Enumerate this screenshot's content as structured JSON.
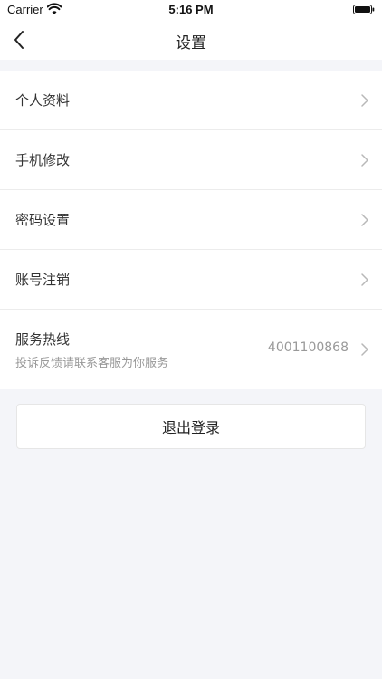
{
  "status_bar": {
    "carrier": "Carrier",
    "time": "5:16 PM"
  },
  "nav": {
    "title": "设置",
    "back_icon": "chevron-left-icon"
  },
  "settings": {
    "items": [
      {
        "label": "个人资料",
        "icon": "chevron-right-icon"
      },
      {
        "label": "手机修改",
        "icon": "chevron-right-icon"
      },
      {
        "label": "密码设置",
        "icon": "chevron-right-icon"
      },
      {
        "label": "账号注销",
        "icon": "chevron-right-icon"
      }
    ],
    "hotline": {
      "label": "服务热线",
      "subtitle": "投诉反馈请联系客服为你服务",
      "value": "4001100868",
      "icon": "chevron-right-icon"
    }
  },
  "logout": {
    "label": "退出登录"
  },
  "colors": {
    "background": "#f4f5f9",
    "surface": "#ffffff",
    "text_primary": "#333333",
    "text_secondary": "#999999",
    "divider": "#ececec"
  }
}
